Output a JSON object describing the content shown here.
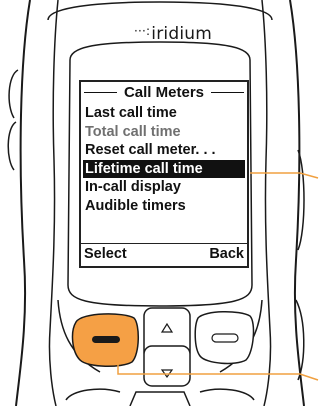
{
  "device": {
    "brand": "iridium",
    "brand_dots": "···:"
  },
  "screen": {
    "title": "Call Meters",
    "menu_items": [
      {
        "label": "Last call time",
        "state": "normal"
      },
      {
        "label": "Total call time",
        "state": "dimmed"
      },
      {
        "label": "Reset call meter. . .",
        "state": "normal"
      },
      {
        "label": "Lifetime call time",
        "state": "selected"
      },
      {
        "label": "In-call display",
        "state": "normal"
      },
      {
        "label": "Audible timers",
        "state": "normal"
      }
    ],
    "softkeys": {
      "left": "Select",
      "right": "Back"
    }
  },
  "keys": {
    "left_softkey_color": "#F5A045",
    "up_arrow": "up-arrow-icon",
    "down_arrow": "down-arrow-icon"
  },
  "colors": {
    "callout_line": "#F0A040",
    "highlight_bg": "#111111",
    "highlight_fg": "#FFFFFF"
  }
}
